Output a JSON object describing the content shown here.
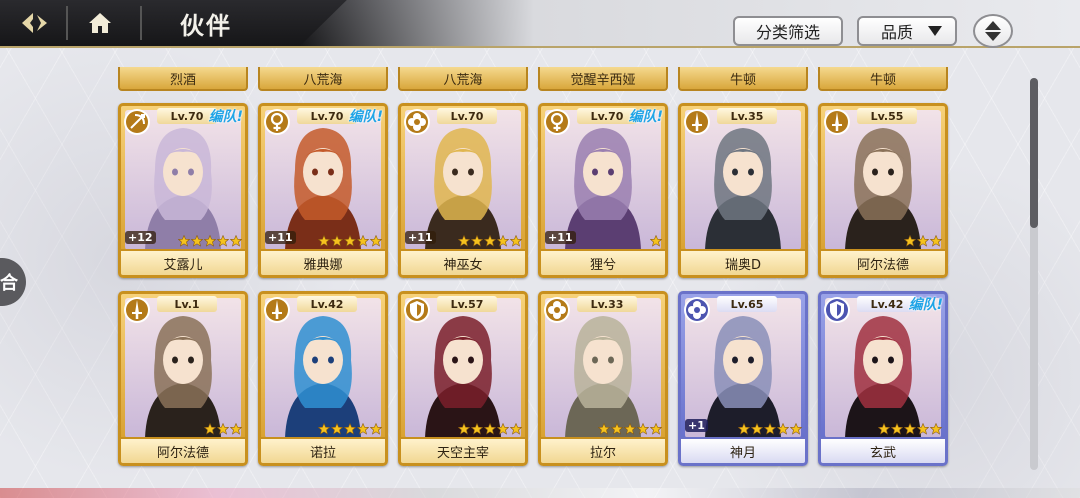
{
  "header": {
    "title": "伙伴",
    "filter_label": "分类筛选",
    "quality_label": "品质"
  },
  "side_tab": {
    "label": "合"
  },
  "partial_row": [
    "烈酒",
    "八荒海",
    "八荒海",
    "觉醒辛西娅",
    "牛顿",
    "牛顿"
  ],
  "cards": [
    {
      "name": "艾露儿",
      "level": "Lv.70",
      "team": "编队!",
      "class": "bow-icon",
      "plus": "+12",
      "stars": 5,
      "frame": "gold",
      "palette": [
        "#f2e3e8",
        "#c9b7d8",
        "#8f7ea8"
      ]
    },
    {
      "name": "雅典娜",
      "level": "Lv.70",
      "team": "编队!",
      "class": "venus-icon",
      "plus": "+11",
      "stars": 5,
      "frame": "gold",
      "palette": [
        "#f4c79a",
        "#c45a2a",
        "#7a2e18"
      ]
    },
    {
      "name": "神巫女",
      "level": "Lv.70",
      "team": "",
      "class": "clover-icon",
      "plus": "+11",
      "stars": 5,
      "frame": "gold",
      "palette": [
        "#fbe9b7",
        "#e0b64f",
        "#3a2a1e"
      ]
    },
    {
      "name": "狸兮",
      "level": "Lv.70",
      "team": "编队!",
      "class": "venus-icon",
      "plus": "+11",
      "stars": 1,
      "frame": "gold",
      "palette": [
        "#efe4ec",
        "#9a7fb0",
        "#5b3e72"
      ]
    },
    {
      "name": "瑞奥D",
      "level": "Lv.35",
      "team": "",
      "class": "sword-icon",
      "plus": "",
      "stars": 0,
      "frame": "gold",
      "palette": [
        "#c9ccd1",
        "#6e7580",
        "#2b2f36"
      ]
    },
    {
      "name": "阿尔法德",
      "level": "Lv.55",
      "team": "",
      "class": "sword-icon",
      "plus": "",
      "stars": 3,
      "frame": "gold",
      "palette": [
        "#e9dcc6",
        "#8a7158",
        "#2a221c"
      ]
    },
    {
      "name": "阿尔法德",
      "level": "Lv.1",
      "team": "",
      "class": "sword-icon",
      "plus": "",
      "stars": 3,
      "frame": "gold",
      "palette": [
        "#e9dcc6",
        "#8a7158",
        "#2a221c"
      ]
    },
    {
      "name": "诺拉",
      "level": "Lv.42",
      "team": "",
      "class": "sword-icon",
      "plus": "",
      "stars": 5,
      "frame": "gold",
      "palette": [
        "#7fd0f2",
        "#2f8fd1",
        "#1c3f7a"
      ]
    },
    {
      "name": "天空主宰",
      "level": "Lv.57",
      "team": "",
      "class": "shield-icon",
      "plus": "",
      "stars": 5,
      "frame": "gold",
      "palette": [
        "#d9b46a",
        "#7a1f2a",
        "#2a1416"
      ]
    },
    {
      "name": "拉尔",
      "level": "Lv.33",
      "team": "",
      "class": "clover-icon",
      "plus": "",
      "stars": 5,
      "frame": "gold",
      "palette": [
        "#ece6d6",
        "#b9b39a",
        "#6c6756"
      ]
    },
    {
      "name": "神月",
      "level": "Lv.65",
      "team": "",
      "class": "clover-icon",
      "plus": "+1",
      "stars": 5,
      "frame": "blue",
      "palette": [
        "#eef0f9",
        "#8a8fb8",
        "#1d1d2a"
      ]
    },
    {
      "name": "玄武",
      "level": "Lv.42",
      "team": "编队!",
      "class": "shield-icon",
      "plus": "",
      "stars": 5,
      "frame": "blue",
      "palette": [
        "#f0e8ea",
        "#a03040",
        "#1c1418"
      ]
    }
  ],
  "colors": {
    "gold_frame": "#c8901e",
    "blue_frame": "#6a72c9",
    "team_tag": "#21a4e6",
    "star": "#f5c21e"
  }
}
